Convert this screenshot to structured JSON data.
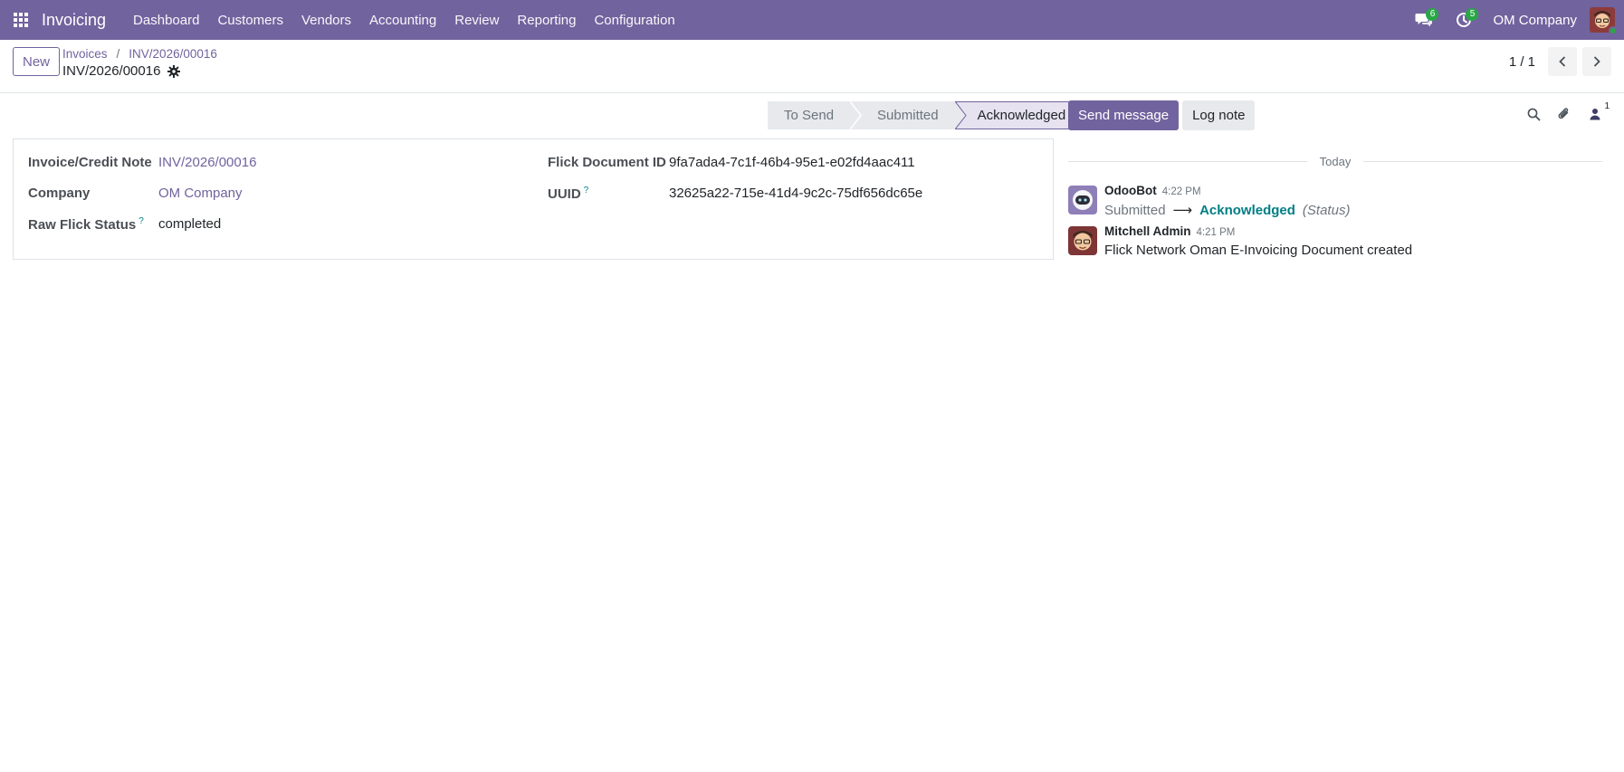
{
  "navbar": {
    "app_name": "Invoicing",
    "menu": [
      "Dashboard",
      "Customers",
      "Vendors",
      "Accounting",
      "Review",
      "Reporting",
      "Configuration"
    ],
    "messages_badge": "6",
    "activities_badge": "5",
    "company": "OM Company",
    "accent_color": "#71639e"
  },
  "control_panel": {
    "new_label": "New",
    "breadcrumb": [
      "Invoices",
      "INV/2026/00016"
    ],
    "separator": "/",
    "record_title": "INV/2026/00016",
    "pager_value": "1 / 1"
  },
  "statusbar": {
    "stages": [
      "To Send",
      "Submitted",
      "Acknowledged"
    ],
    "active_stage": "Acknowledged"
  },
  "form": {
    "left": [
      {
        "label": "Invoice/Credit Note",
        "help": "",
        "value": "INV/2026/00016",
        "link": true
      },
      {
        "label": "Company",
        "help": "",
        "value": "OM Company",
        "link": true
      },
      {
        "label": "Raw Flick Status",
        "help": "?",
        "value": "completed",
        "link": false
      }
    ],
    "right": [
      {
        "label": "Flick Document ID",
        "help": "",
        "value": "9fa7ada4-7c1f-46b4-95e1-e02fd4aac411"
      },
      {
        "label": "UUID",
        "help": "?",
        "value": "32625a22-715e-41d4-9c2c-75df656dc65e"
      }
    ]
  },
  "chatter": {
    "send_message_label": "Send message",
    "log_note_label": "Log note",
    "followers_count": "1",
    "date_separator": "Today",
    "messages": [
      {
        "author": "OdooBot",
        "time": "4:22 PM",
        "tracking_old": "Submitted",
        "tracking_arrow": "⟶",
        "tracking_new": "Acknowledged",
        "tracking_field": "(Status)"
      },
      {
        "author": "Mitchell Admin",
        "time": "4:21 PM",
        "body": "Flick Network Oman E-Invoicing Document created"
      }
    ]
  }
}
